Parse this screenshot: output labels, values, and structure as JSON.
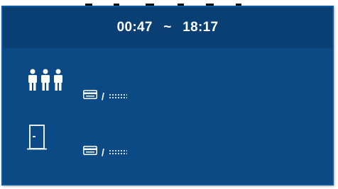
{
  "header": {
    "start_time": "00:47",
    "separator": "~",
    "end_time": "18:17"
  },
  "rows": [
    {
      "icon": "people-group-icon",
      "card_icon": "card-icon",
      "slash": "/",
      "masked_value": "****"
    },
    {
      "icon": "door-icon",
      "card_icon": "card-icon",
      "slash": "/",
      "masked_value": "****"
    }
  ],
  "colors": {
    "panel_bg": "#0b4a85",
    "header_bg": "#093f72",
    "text": "#ffffff"
  }
}
